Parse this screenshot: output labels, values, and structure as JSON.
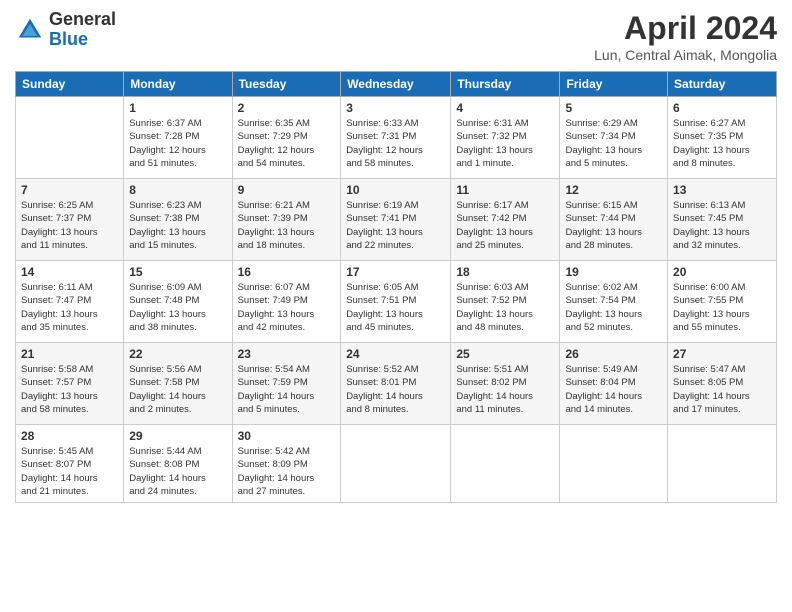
{
  "logo": {
    "general": "General",
    "blue": "Blue"
  },
  "title": "April 2024",
  "subtitle": "Lun, Central Aimak, Mongolia",
  "days_of_week": [
    "Sunday",
    "Monday",
    "Tuesday",
    "Wednesday",
    "Thursday",
    "Friday",
    "Saturday"
  ],
  "weeks": [
    [
      {
        "day": "",
        "detail": ""
      },
      {
        "day": "1",
        "detail": "Sunrise: 6:37 AM\nSunset: 7:28 PM\nDaylight: 12 hours\nand 51 minutes."
      },
      {
        "day": "2",
        "detail": "Sunrise: 6:35 AM\nSunset: 7:29 PM\nDaylight: 12 hours\nand 54 minutes."
      },
      {
        "day": "3",
        "detail": "Sunrise: 6:33 AM\nSunset: 7:31 PM\nDaylight: 12 hours\nand 58 minutes."
      },
      {
        "day": "4",
        "detail": "Sunrise: 6:31 AM\nSunset: 7:32 PM\nDaylight: 13 hours\nand 1 minute."
      },
      {
        "day": "5",
        "detail": "Sunrise: 6:29 AM\nSunset: 7:34 PM\nDaylight: 13 hours\nand 5 minutes."
      },
      {
        "day": "6",
        "detail": "Sunrise: 6:27 AM\nSunset: 7:35 PM\nDaylight: 13 hours\nand 8 minutes."
      }
    ],
    [
      {
        "day": "7",
        "detail": "Sunrise: 6:25 AM\nSunset: 7:37 PM\nDaylight: 13 hours\nand 11 minutes."
      },
      {
        "day": "8",
        "detail": "Sunrise: 6:23 AM\nSunset: 7:38 PM\nDaylight: 13 hours\nand 15 minutes."
      },
      {
        "day": "9",
        "detail": "Sunrise: 6:21 AM\nSunset: 7:39 PM\nDaylight: 13 hours\nand 18 minutes."
      },
      {
        "day": "10",
        "detail": "Sunrise: 6:19 AM\nSunset: 7:41 PM\nDaylight: 13 hours\nand 22 minutes."
      },
      {
        "day": "11",
        "detail": "Sunrise: 6:17 AM\nSunset: 7:42 PM\nDaylight: 13 hours\nand 25 minutes."
      },
      {
        "day": "12",
        "detail": "Sunrise: 6:15 AM\nSunset: 7:44 PM\nDaylight: 13 hours\nand 28 minutes."
      },
      {
        "day": "13",
        "detail": "Sunrise: 6:13 AM\nSunset: 7:45 PM\nDaylight: 13 hours\nand 32 minutes."
      }
    ],
    [
      {
        "day": "14",
        "detail": "Sunrise: 6:11 AM\nSunset: 7:47 PM\nDaylight: 13 hours\nand 35 minutes."
      },
      {
        "day": "15",
        "detail": "Sunrise: 6:09 AM\nSunset: 7:48 PM\nDaylight: 13 hours\nand 38 minutes."
      },
      {
        "day": "16",
        "detail": "Sunrise: 6:07 AM\nSunset: 7:49 PM\nDaylight: 13 hours\nand 42 minutes."
      },
      {
        "day": "17",
        "detail": "Sunrise: 6:05 AM\nSunset: 7:51 PM\nDaylight: 13 hours\nand 45 minutes."
      },
      {
        "day": "18",
        "detail": "Sunrise: 6:03 AM\nSunset: 7:52 PM\nDaylight: 13 hours\nand 48 minutes."
      },
      {
        "day": "19",
        "detail": "Sunrise: 6:02 AM\nSunset: 7:54 PM\nDaylight: 13 hours\nand 52 minutes."
      },
      {
        "day": "20",
        "detail": "Sunrise: 6:00 AM\nSunset: 7:55 PM\nDaylight: 13 hours\nand 55 minutes."
      }
    ],
    [
      {
        "day": "21",
        "detail": "Sunrise: 5:58 AM\nSunset: 7:57 PM\nDaylight: 13 hours\nand 58 minutes."
      },
      {
        "day": "22",
        "detail": "Sunrise: 5:56 AM\nSunset: 7:58 PM\nDaylight: 14 hours\nand 2 minutes."
      },
      {
        "day": "23",
        "detail": "Sunrise: 5:54 AM\nSunset: 7:59 PM\nDaylight: 14 hours\nand 5 minutes."
      },
      {
        "day": "24",
        "detail": "Sunrise: 5:52 AM\nSunset: 8:01 PM\nDaylight: 14 hours\nand 8 minutes."
      },
      {
        "day": "25",
        "detail": "Sunrise: 5:51 AM\nSunset: 8:02 PM\nDaylight: 14 hours\nand 11 minutes."
      },
      {
        "day": "26",
        "detail": "Sunrise: 5:49 AM\nSunset: 8:04 PM\nDaylight: 14 hours\nand 14 minutes."
      },
      {
        "day": "27",
        "detail": "Sunrise: 5:47 AM\nSunset: 8:05 PM\nDaylight: 14 hours\nand 17 minutes."
      }
    ],
    [
      {
        "day": "28",
        "detail": "Sunrise: 5:45 AM\nSunset: 8:07 PM\nDaylight: 14 hours\nand 21 minutes."
      },
      {
        "day": "29",
        "detail": "Sunrise: 5:44 AM\nSunset: 8:08 PM\nDaylight: 14 hours\nand 24 minutes."
      },
      {
        "day": "30",
        "detail": "Sunrise: 5:42 AM\nSunset: 8:09 PM\nDaylight: 14 hours\nand 27 minutes."
      },
      {
        "day": "",
        "detail": ""
      },
      {
        "day": "",
        "detail": ""
      },
      {
        "day": "",
        "detail": ""
      },
      {
        "day": "",
        "detail": ""
      }
    ]
  ]
}
